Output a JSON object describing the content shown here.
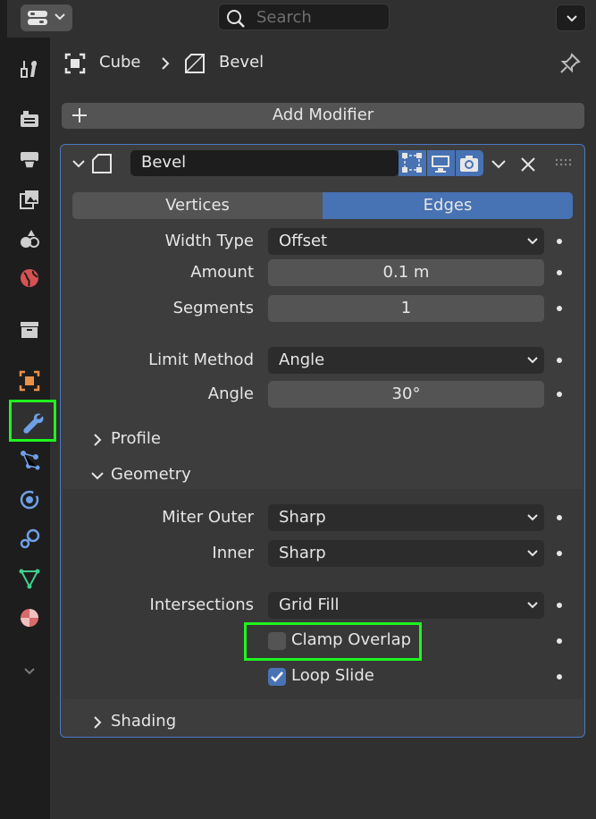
{
  "header": {
    "search_placeholder": "Search",
    "editor_type_icon": "properties-editor-icon",
    "menu_icon": "chevron-down-icon"
  },
  "tabs": [
    {
      "name": "tool",
      "icon": "wrench-screwdriver-icon"
    },
    {
      "name": "render",
      "icon": "camera-back-icon"
    },
    {
      "name": "output",
      "icon": "printer-icon"
    },
    {
      "name": "view-layer",
      "icon": "images-icon"
    },
    {
      "name": "scene",
      "icon": "scene-icon"
    },
    {
      "name": "world",
      "icon": "globe-icon"
    },
    {
      "name": "collection",
      "icon": "box-icon"
    },
    {
      "name": "object",
      "icon": "object-square-icon"
    },
    {
      "name": "modifiers",
      "icon": "wrench-icon",
      "active": true
    },
    {
      "name": "particles",
      "icon": "particles-icon"
    },
    {
      "name": "physics",
      "icon": "physics-orbit-icon"
    },
    {
      "name": "constraints",
      "icon": "constraint-icon"
    },
    {
      "name": "data",
      "icon": "mesh-triangle-icon"
    },
    {
      "name": "material",
      "icon": "material-sphere-icon"
    }
  ],
  "breadcrumb": {
    "object": "Cube",
    "modifier": "Bevel"
  },
  "add_modifier_label": "Add Modifier",
  "modifier": {
    "name": "Bevel",
    "affect_options": [
      "Vertices",
      "Edges"
    ],
    "affect_selected": "Edges",
    "width_type_label": "Width Type",
    "width_type": "Offset",
    "amount_label": "Amount",
    "amount": "0.1 m",
    "segments_label": "Segments",
    "segments": "1",
    "limit_method_label": "Limit Method",
    "limit_method": "Angle",
    "angle_label": "Angle",
    "angle": "30°",
    "profile_label": "Profile",
    "geometry_label": "Geometry",
    "miter_outer_label": "Miter Outer",
    "miter_outer": "Sharp",
    "inner_label": "Inner",
    "inner": "Sharp",
    "intersections_label": "Intersections",
    "intersections": "Grid Fill",
    "clamp_overlap_label": "Clamp Overlap",
    "clamp_overlap": false,
    "loop_slide_label": "Loop Slide",
    "loop_slide": true,
    "shading_label": "Shading"
  },
  "colors": {
    "accent": "#4772b3",
    "highlight": "#1ff51f",
    "panel_border": "#4a78c4"
  }
}
